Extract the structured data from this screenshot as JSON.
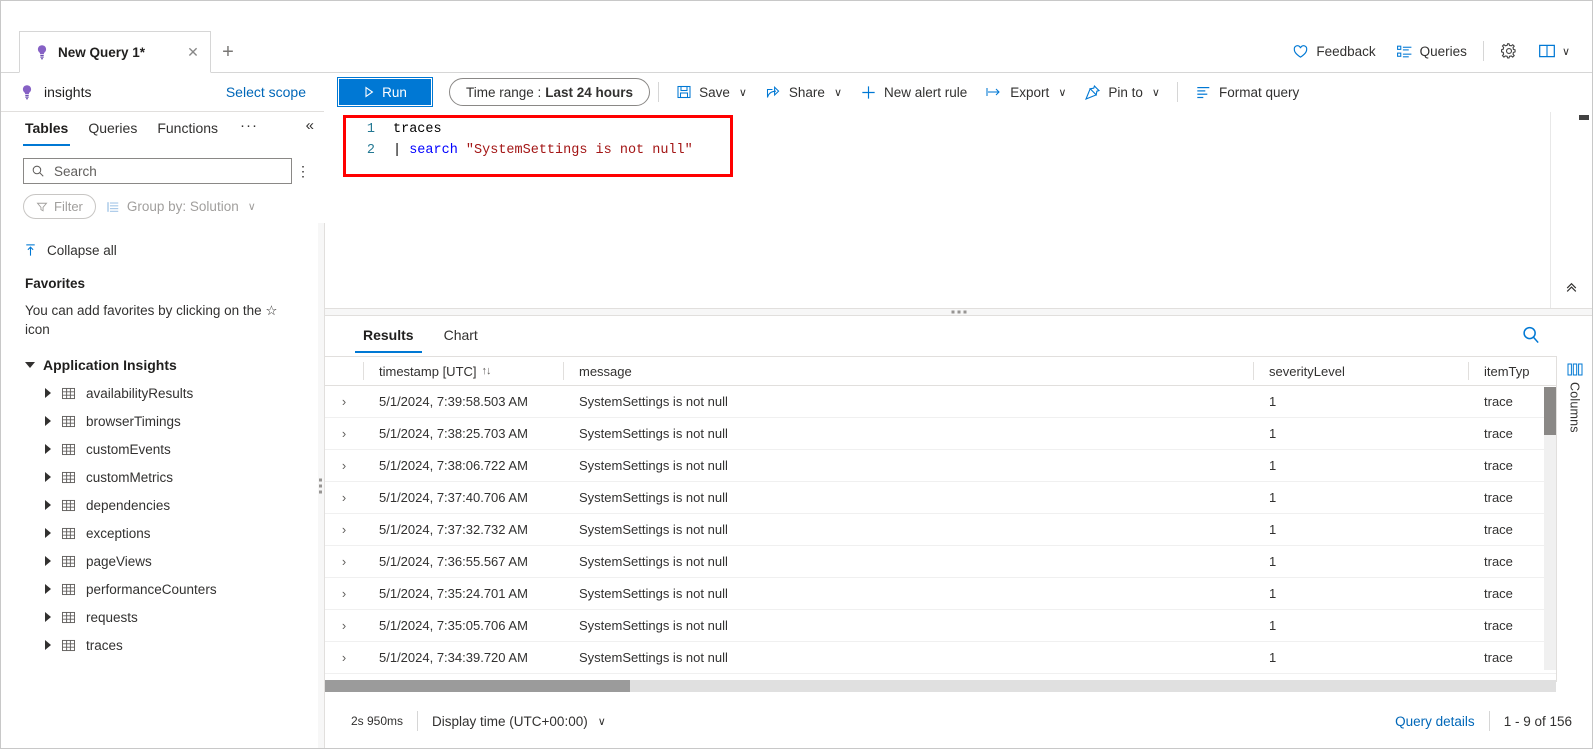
{
  "tab": {
    "label": "New Query 1*",
    "icon": "lightbulb-icon",
    "close": "✕",
    "add": "+"
  },
  "header": {
    "feedback": "Feedback",
    "queries": "Queries",
    "settings_icon": "gear-icon",
    "layout_icon": "book-layout-icon",
    "chevron": "∨"
  },
  "scope": {
    "name": "insights",
    "select_scope": "Select scope"
  },
  "toolbar": {
    "run": "Run",
    "run_icon": "play-icon",
    "time_range_label": "Time range :",
    "time_range_value": "Last 24 hours",
    "save": "Save",
    "share": "Share",
    "new_alert_rule": "New alert rule",
    "export": "Export",
    "pin_to": "Pin to",
    "format_query": "Format query",
    "chevron": "∨"
  },
  "sidebar": {
    "tabs": [
      {
        "label": "Tables",
        "active": true
      },
      {
        "label": "Queries",
        "active": false
      },
      {
        "label": "Functions",
        "active": false
      }
    ],
    "more": "···",
    "collapse_panel": "«",
    "search_placeholder": "Search",
    "search_value": "",
    "kebab": "⋮",
    "filter": "Filter",
    "group_by": "Group by: Solution",
    "collapse_all": "Collapse all",
    "favorites_title": "Favorites",
    "favorites_text": "You can add favorites by clicking on the ☆ icon",
    "group_title": "Application Insights",
    "tables": [
      "availabilityResults",
      "browserTimings",
      "customEvents",
      "customMetrics",
      "dependencies",
      "exceptions",
      "pageViews",
      "performanceCounters",
      "requests",
      "traces"
    ]
  },
  "editor": {
    "lines": [
      {
        "no": "1",
        "tokens": [
          {
            "t": "traces",
            "c": "plain"
          }
        ]
      },
      {
        "no": "2",
        "tokens": [
          {
            "t": "| ",
            "c": "op"
          },
          {
            "t": "search ",
            "c": "cmd"
          },
          {
            "t": "\"SystemSettings is not null\"",
            "c": "str"
          }
        ]
      }
    ],
    "highlight_color": "#ff0000",
    "collapse_icon": "chevron-double-up-icon"
  },
  "results": {
    "tabs": [
      {
        "label": "Results",
        "active": true
      },
      {
        "label": "Chart",
        "active": false
      }
    ],
    "search_icon": "search-icon",
    "columns": [
      {
        "key": "expand",
        "label": ""
      },
      {
        "key": "timestamp",
        "label": "timestamp [UTC]",
        "sortable": true
      },
      {
        "key": "message",
        "label": "message"
      },
      {
        "key": "severityLevel",
        "label": "severityLevel"
      },
      {
        "key": "itemType",
        "label": "itemTyp"
      }
    ],
    "rows": [
      {
        "expand": "›",
        "timestamp": "5/1/2024, 7:39:58.503 AM",
        "message": "SystemSettings is not null",
        "severityLevel": "1",
        "itemType": "trace"
      },
      {
        "expand": "›",
        "timestamp": "5/1/2024, 7:38:25.703 AM",
        "message": "SystemSettings is not null",
        "severityLevel": "1",
        "itemType": "trace"
      },
      {
        "expand": "›",
        "timestamp": "5/1/2024, 7:38:06.722 AM",
        "message": "SystemSettings is not null",
        "severityLevel": "1",
        "itemType": "trace"
      },
      {
        "expand": "›",
        "timestamp": "5/1/2024, 7:37:40.706 AM",
        "message": "SystemSettings is not null",
        "severityLevel": "1",
        "itemType": "trace"
      },
      {
        "expand": "›",
        "timestamp": "5/1/2024, 7:37:32.732 AM",
        "message": "SystemSettings is not null",
        "severityLevel": "1",
        "itemType": "trace"
      },
      {
        "expand": "›",
        "timestamp": "5/1/2024, 7:36:55.567 AM",
        "message": "SystemSettings is not null",
        "severityLevel": "1",
        "itemType": "trace"
      },
      {
        "expand": "›",
        "timestamp": "5/1/2024, 7:35:24.701 AM",
        "message": "SystemSettings is not null",
        "severityLevel": "1",
        "itemType": "trace"
      },
      {
        "expand": "›",
        "timestamp": "5/1/2024, 7:35:05.706 AM",
        "message": "SystemSettings is not null",
        "severityLevel": "1",
        "itemType": "trace"
      },
      {
        "expand": "›",
        "timestamp": "5/1/2024, 7:34:39.720 AM",
        "message": "SystemSettings is not null",
        "severityLevel": "1",
        "itemType": "trace"
      }
    ],
    "columns_rail_label": "Columns",
    "columns_rail_icon": "columns-icon",
    "footer": {
      "duration": "2s 950ms",
      "display_time": "Display time (UTC+00:00)",
      "query_details": "Query details",
      "row_count": "1 - 9 of 156"
    }
  },
  "theme": {
    "accent": "#0078d4",
    "link": "#0067b8",
    "highlight": "#ff0000",
    "keyword": "#0000ff",
    "string": "#a31515"
  }
}
